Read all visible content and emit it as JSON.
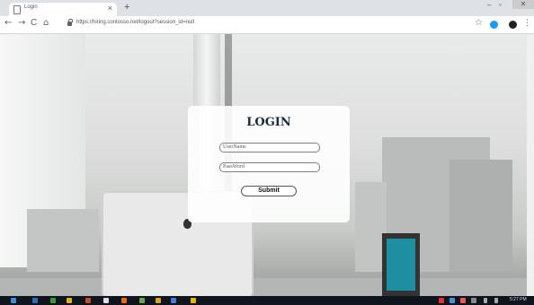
{
  "browser": {
    "tab_title": "Login",
    "tab_close": "×",
    "new_tab": "+",
    "url": "https://hiring.contosso.net/logout?session_id=null",
    "window_buttons": {
      "minimize": "–",
      "maximize": "▫",
      "close": "✕"
    },
    "nav": {
      "back": "←",
      "forward": "→",
      "reload": "C",
      "home": "⌂"
    },
    "star": "☆",
    "menu": "⋮"
  },
  "login": {
    "title": "LOGIN",
    "username_placeholder": "UserName",
    "password_placeholder": "PassWord",
    "submit_label": "Submit"
  },
  "taskbar": {
    "clock": "5:27 PM"
  },
  "colors": {
    "accent": "#1a9bf0",
    "title": "#1b2b3a",
    "taskbar": "#10151d"
  }
}
